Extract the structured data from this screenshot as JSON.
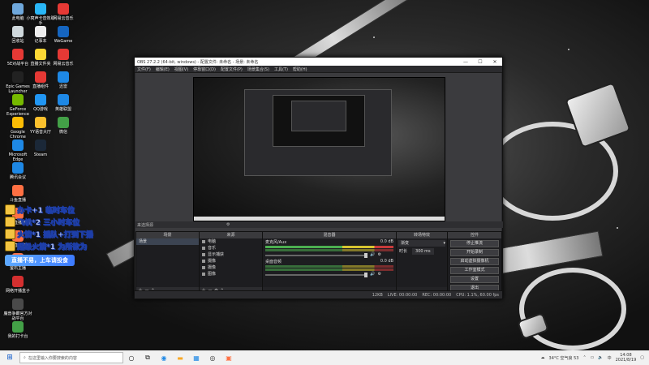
{
  "desktop": {
    "icons": [
      {
        "label": "此电脑",
        "color": "#6fa8dc"
      },
      {
        "label": "回收站",
        "color": "#cfd8dc"
      },
      {
        "label": "5E对战平台",
        "color": "#e53935"
      },
      {
        "label": "Epic Games Launcher",
        "color": "#222"
      },
      {
        "label": "GeForce Experience",
        "color": "#76b900"
      },
      {
        "label": "Google Chrome",
        "color": "#fbbc05"
      },
      {
        "label": "Microsoft Edge",
        "color": "#1e88e5"
      },
      {
        "label": "腾讯会议",
        "color": "#1e88e5"
      },
      {
        "label": "斗鱼直播",
        "color": "#ff7043"
      },
      {
        "label": "斗鱼直播伴侣",
        "color": "#ff7043"
      },
      {
        "label": "斗鱼直播管家",
        "color": "#ff7043"
      },
      {
        "label": "萤石主播",
        "color": "#ff7043"
      },
      {
        "label": "网络开播盒子",
        "color": "#d32f2f"
      },
      {
        "label": "魔兽争霸官方对战平台",
        "color": "#4a4a4a"
      },
      {
        "label": "我的打卡台",
        "color": "#43a047"
      },
      {
        "label": "小窝声卡音效助手",
        "color": "#29b6f6"
      },
      {
        "label": "记事本",
        "color": "#eeeeee"
      },
      {
        "label": "直播文件夹",
        "color": "#fdd835"
      },
      {
        "label": "直播组件",
        "color": "#e53935"
      },
      {
        "label": "QQ游戏",
        "color": "#2196f3"
      },
      {
        "label": "YY语音大厅",
        "color": "#fbc02d"
      },
      {
        "label": "Steam",
        "color": "#1b2838"
      },
      {
        "label": "网易云音乐",
        "color": "#e53935"
      },
      {
        "label": "WeGame",
        "color": "#1565c0"
      },
      {
        "label": "网易云音乐",
        "color": "#e53935"
      },
      {
        "label": "迅雷",
        "color": "#1e88e5"
      },
      {
        "label": "英雄联盟",
        "color": "#1e88e5"
      },
      {
        "label": "微信",
        "color": "#43a047"
      }
    ]
  },
  "overlay": {
    "lines": [
      "办卡+1 临时车位",
      "飞机*2 三小时车位",
      "火箭*1 插队+打到下播",
      "超级火箭*1 为所欲为"
    ],
    "banner": "直播不易，上车请投食"
  },
  "obs": {
    "title": "OBS 27.2.2 (64-bit, windows) - 配置文件: 未命名 - 场景: 未命名",
    "menu": [
      "文件(F)",
      "编辑(E)",
      "视图(V)",
      "停靠窗口(D)",
      "配置文件(P)",
      "场景集合(S)",
      "工具(T)",
      "帮助(H)"
    ],
    "context_bar": "来选择源",
    "scenes": {
      "title": "场景",
      "items": [
        "场景"
      ]
    },
    "sources": {
      "title": "来源",
      "items": [
        "电脑",
        "音乐",
        "显示捕获",
        "摄像",
        "摄像",
        "图像"
      ]
    },
    "mixer": {
      "title": "混音器",
      "channels": [
        {
          "name": "麦克风/Aux",
          "db": "0.0 dB"
        },
        {
          "name": "桌面音频",
          "db": "0.0 dB"
        }
      ]
    },
    "transitions": {
      "title": "转场特效",
      "type": "渐变",
      "duration_label": "时长",
      "duration": "300 ms"
    },
    "controls": {
      "title": "控件",
      "buttons": [
        "停止推流",
        "开始录制",
        "启动虚拟摄像机",
        "工作室模式",
        "设置",
        "退出"
      ]
    },
    "status": {
      "live": "LIVE: 00:00:00",
      "rec": "REC: 00:00:00",
      "cpu": "CPU: 1.1%, 60.00 fps",
      "dropped": "12KB"
    }
  },
  "taskbar": {
    "search_placeholder": "在这里输入你要搜索的内容",
    "weather": "34°C 空气良 53",
    "time": "14:08",
    "date": "2021/8/19"
  }
}
